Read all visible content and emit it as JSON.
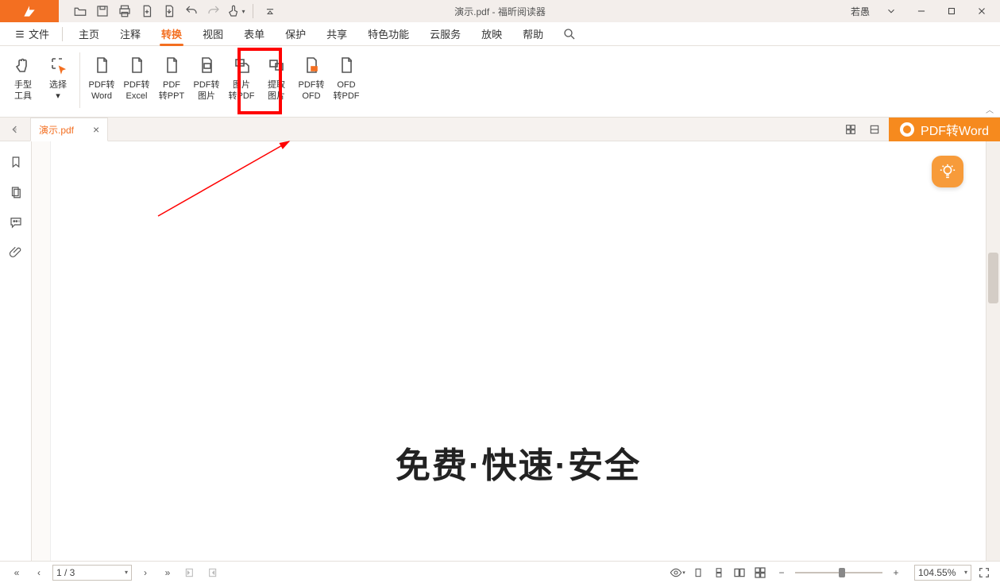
{
  "title_doc": "演示.pdf",
  "title_app": "福昕阅读器",
  "title_full": "演示.pdf - 福昕阅读器",
  "user_name": "若愚",
  "file_menu_label": "文件",
  "menu_tabs": [
    "主页",
    "注释",
    "转换",
    "视图",
    "表单",
    "保护",
    "共享",
    "特色功能",
    "云服务",
    "放映",
    "帮助"
  ],
  "active_menu_tab": "转换",
  "ribbon": {
    "hand": {
      "l1": "手型",
      "l2": "工具"
    },
    "select": {
      "l1": "选择",
      "l2": ""
    },
    "items": [
      {
        "l1": "PDF转",
        "l2": "Word"
      },
      {
        "l1": "PDF转",
        "l2": "Excel"
      },
      {
        "l1": "PDF",
        "l2": "转PPT"
      },
      {
        "l1": "PDF转",
        "l2": "图片"
      },
      {
        "l1": "图片",
        "l2": "转PDF"
      },
      {
        "l1": "提取",
        "l2": "图片"
      },
      {
        "l1": "PDF转",
        "l2": "OFD"
      },
      {
        "l1": "OFD",
        "l2": "转PDF"
      }
    ]
  },
  "doc_tab_label": "演示.pdf",
  "pdf_to_word_btn": "PDF转Word",
  "page_headline": "免费·快速·安全",
  "status": {
    "page_text": "1 / 3",
    "zoom_text": "104.55%"
  }
}
